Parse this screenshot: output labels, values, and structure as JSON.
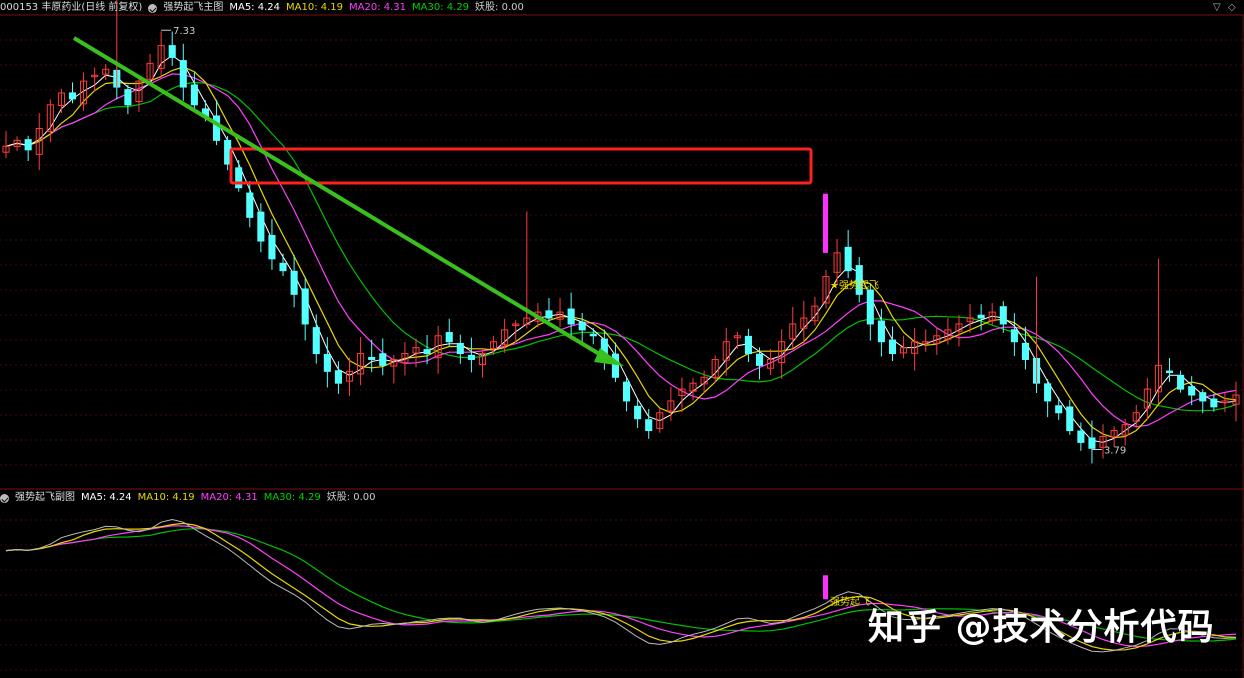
{
  "main_header": {
    "code_title": "000153 丰原药业(日线 前复权)",
    "indicator_name": "强势起飞主图",
    "ma5": "MA5: 4.24",
    "ma10": "MA10: 4.19",
    "ma20": "MA20: 4.31",
    "ma30": "MA30: 4.29",
    "yaogu": "妖股: 0.00"
  },
  "sub_header": {
    "indicator_name": "强势起飞副图",
    "ma5": "MA5: 4.24",
    "ma10": "MA10: 4.19",
    "ma20": "MA20: 4.31",
    "ma30": "MA30: 4.29",
    "yaogu": "妖股: 0.00"
  },
  "annotations": {
    "high_label": "7.33",
    "low_label": "3.79",
    "signal_main": "★强势起飞",
    "signal_sub": "强势起飞"
  },
  "watermark": "知乎 @技术分析代码",
  "colors": {
    "up": "#ff3b3b",
    "down": "#54ffff",
    "ma5": "#ffffff",
    "ma10": "#e8d800",
    "ma20": "#ff40ff",
    "ma30": "#00c000",
    "box": "#ff2020",
    "arrow": "#39c01f",
    "signal": "#ff30ff"
  },
  "chart_data": {
    "type": "candlestick",
    "price_high_label": 7.33,
    "price_low_label": 3.79,
    "close_series": [
      6.35,
      6.4,
      6.32,
      6.5,
      6.7,
      6.8,
      6.75,
      6.9,
      6.95,
      7.0,
      6.85,
      6.7,
      6.9,
      7.05,
      7.2,
      7.1,
      6.85,
      6.7,
      6.6,
      6.4,
      6.2,
      6.0,
      5.75,
      5.55,
      5.4,
      5.3,
      5.1,
      4.85,
      4.6,
      4.45,
      4.35,
      4.45,
      4.6,
      4.55,
      4.5,
      4.55,
      4.6,
      4.65,
      4.6,
      4.75,
      4.7,
      4.6,
      4.55,
      4.6,
      4.7,
      4.8,
      4.85,
      4.9,
      4.95,
      4.9,
      4.95,
      4.85,
      4.8,
      4.75,
      4.6,
      4.4,
      4.2,
      4.05,
      3.95,
      4.1,
      4.2,
      4.3,
      4.35,
      4.4,
      4.55,
      4.7,
      4.75,
      4.6,
      4.5,
      4.55,
      4.7,
      4.85,
      4.9,
      5.0,
      5.25,
      5.45,
      5.3,
      5.1,
      4.85,
      4.7,
      4.6,
      4.65,
      4.7,
      4.7,
      4.75,
      4.8,
      4.85,
      4.9,
      4.9,
      4.95,
      4.85,
      4.7,
      4.55,
      4.35,
      4.2,
      4.1,
      3.95,
      3.85,
      3.8,
      3.9,
      3.95,
      4.0,
      4.1,
      4.3,
      4.5,
      4.45,
      4.3,
      4.25,
      4.2,
      4.15,
      4.2,
      4.25
    ]
  }
}
